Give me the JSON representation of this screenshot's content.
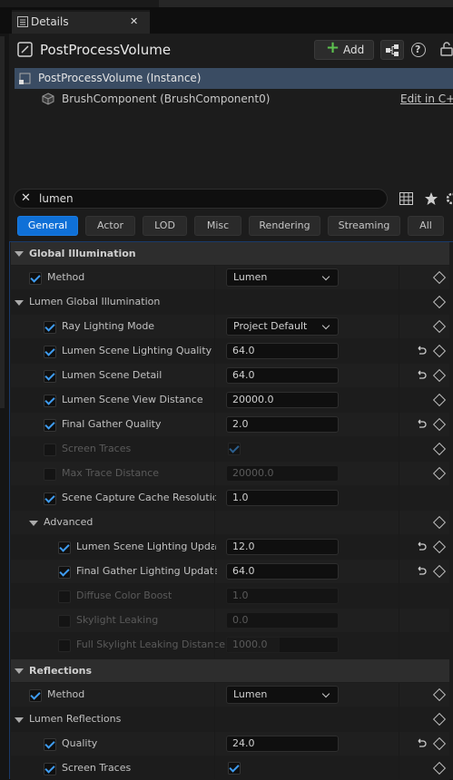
{
  "window": {
    "tab_title": "Details",
    "close_glyph": "✕"
  },
  "header": {
    "object_name": "PostProcessVolume",
    "add_label": "Add",
    "add_plus": "+",
    "help_glyph": "?"
  },
  "components": {
    "instance_label": "PostProcessVolume (Instance)",
    "brush_label": "BrushComponent (BrushComponent0)",
    "edit_link": "Edit in C++"
  },
  "search": {
    "value": "lumen",
    "clear_glyph": "✕"
  },
  "filter_tabs": [
    {
      "label": "General",
      "active": true
    },
    {
      "label": "Actor",
      "active": false
    },
    {
      "label": "LOD",
      "active": false
    },
    {
      "label": "Misc",
      "active": false
    },
    {
      "label": "Rendering",
      "active": false
    },
    {
      "label": "Streaming",
      "active": false
    },
    {
      "label": "All",
      "active": false
    }
  ],
  "sections": {
    "global_illumination": "Global Illumination",
    "lumen_gi": "Lumen Global Illumination",
    "advanced": "Advanced",
    "reflections": "Reflections",
    "lumen_reflections": "Lumen Reflections"
  },
  "properties": {
    "gi_method": {
      "label": "Method",
      "value": "Lumen",
      "checked": true
    },
    "ray_lighting_mode": {
      "label": "Ray Lighting Mode",
      "value": "Project Default",
      "checked": true
    },
    "scene_lighting_quality": {
      "label": "Lumen Scene Lighting Quality",
      "value": "64.0",
      "checked": true
    },
    "scene_detail": {
      "label": "Lumen Scene Detail",
      "value": "64.0",
      "checked": true
    },
    "scene_view_distance": {
      "label": "Lumen Scene View Distance",
      "value": "20000.0",
      "checked": true
    },
    "final_gather_quality": {
      "label": "Final Gather Quality",
      "value": "2.0",
      "checked": true
    },
    "screen_traces": {
      "label": "Screen Traces",
      "checked": false,
      "value_checked": true
    },
    "max_trace_distance": {
      "label": "Max Trace Distance",
      "value": "20000.0",
      "checked": false
    },
    "scene_capture_cache": {
      "label": "Scene Capture Cache Resolutio…",
      "value": "1.0",
      "checked": true
    },
    "scene_lighting_update": {
      "label": "Lumen Scene Lighting Updat…",
      "value": "12.0",
      "checked": true
    },
    "final_gather_lighting_update": {
      "label": "Final Gather Lighting Update…",
      "value": "64.0",
      "checked": true
    },
    "diffuse_color_boost": {
      "label": "Diffuse Color Boost",
      "value": "1.0",
      "checked": false
    },
    "skylight_leaking": {
      "label": "Skylight Leaking",
      "value": "0.0",
      "checked": false
    },
    "full_skylight_leaking_distance": {
      "label": "Full Skylight Leaking Distance",
      "value": "1000.0",
      "checked": false
    },
    "refl_method": {
      "label": "Method",
      "value": "Lumen",
      "checked": true
    },
    "refl_quality": {
      "label": "Quality",
      "value": "24.0",
      "checked": true
    },
    "refl_screen_traces": {
      "label": "Screen Traces",
      "checked": true,
      "value_checked": true
    }
  },
  "colors": {
    "accent": "#0f70d7",
    "check": "#3f9cf0",
    "panel": "#1c1c1c",
    "header_row": "#2d2d2d",
    "selected_row": "#3a4c63"
  }
}
